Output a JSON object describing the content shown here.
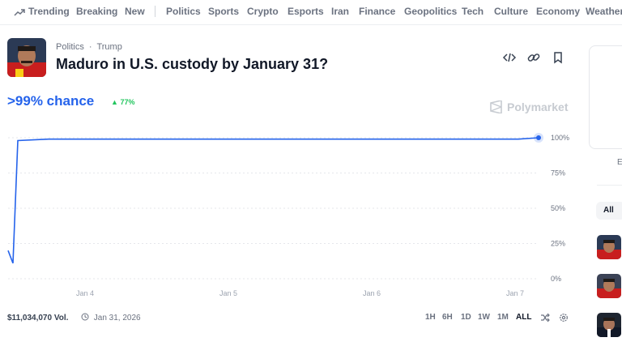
{
  "nav": {
    "items": [
      "Trending",
      "Breaking",
      "New",
      "Politics",
      "Sports",
      "Crypto",
      "Esports",
      "Iran",
      "Finance",
      "Geopolitics",
      "Tech",
      "Culture",
      "Economy",
      "Weather"
    ]
  },
  "market": {
    "breadcrumb_category": "Politics",
    "breadcrumb_sep": "·",
    "breadcrumb_tag": "Trump",
    "title": "Maduro in U.S. custody by January 31?",
    "chance": ">99% chance",
    "delta": "77%",
    "brand": "Polymarket",
    "volume": "$11,034,070 Vol.",
    "end_date": "Jan 31, 2026"
  },
  "icons": [
    "trending-icon",
    "embed-icon",
    "link-icon",
    "bookmark-icon",
    "clock-icon",
    "shuffle-icon",
    "settings-icon",
    "polymarket-logo-icon"
  ],
  "time_ranges": {
    "items": [
      "1H",
      "6H",
      "1D",
      "1W",
      "1M",
      "ALL"
    ],
    "selected": "ALL"
  },
  "right_panel": {
    "letter": "E",
    "filter": "All"
  },
  "colors": {
    "accent": "#2563eb",
    "up": "#22c55e",
    "muted": "#6b7280"
  },
  "chart_data": {
    "type": "line",
    "series": [
      {
        "values": [
          20,
          11,
          98,
          99,
          99,
          99,
          99,
          99,
          99,
          99,
          99,
          100
        ]
      }
    ],
    "x": [
      "Jan 3",
      "Jan 3",
      "Jan 3",
      "Jan 4",
      "Jan 4",
      "Jan 5",
      "Jan 5",
      "Jan 6",
      "Jan 6",
      "Jan 7",
      "Jan 7",
      "Jan 7"
    ],
    "x_ticks": [
      "Jan 4",
      "Jan 5",
      "Jan 6",
      "Jan 7"
    ],
    "y_ticks": [
      "100%",
      "75%",
      "50%",
      "25%",
      "0%"
    ],
    "ylim": [
      0,
      100
    ],
    "grid": true
  }
}
